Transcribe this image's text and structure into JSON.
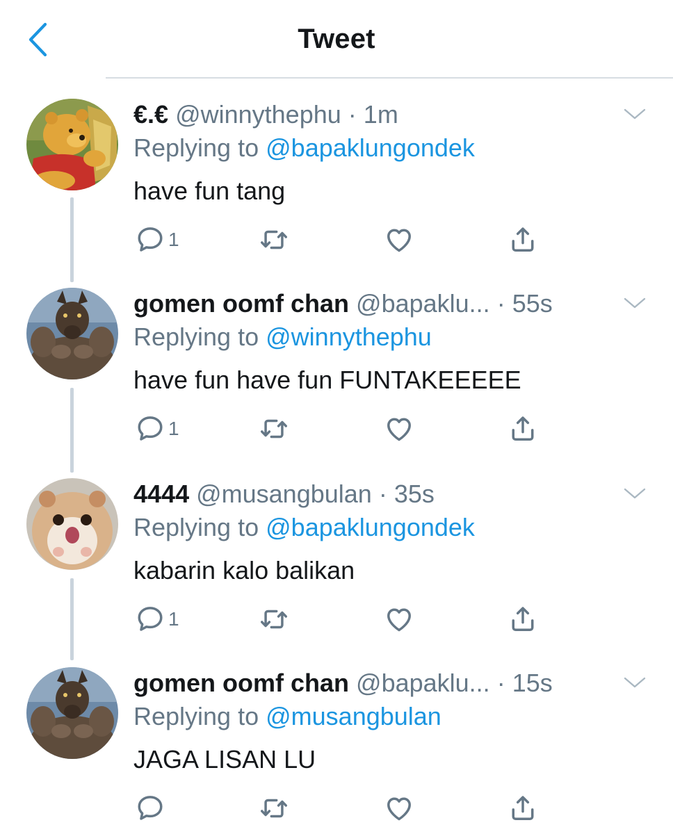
{
  "header": {
    "title": "Tweet",
    "back_icon": "chevron-left-icon",
    "accent_color": "#1b95e0"
  },
  "tweets": [
    {
      "display_name": "€.€",
      "handle": "@winnythephu",
      "dot": "·",
      "time": "1m",
      "replying_prefix": "Replying to",
      "replying_to": "@bapaklungondek",
      "text": "have fun tang",
      "reply_count": "1",
      "avatar": "pooh-bear-avatar"
    },
    {
      "display_name": "gomen oomf chan",
      "handle": "@bapaklu...",
      "dot": "·",
      "time": "55s",
      "replying_prefix": "Replying to",
      "replying_to": "@winnythephu",
      "text": "have fun have fun FUNTAKEEEEE",
      "reply_count": "1",
      "avatar": "werewolf-avatar"
    },
    {
      "display_name": "4444",
      "handle": "@musangbulan",
      "dot": "·",
      "time": "35s",
      "replying_prefix": "Replying to",
      "replying_to": "@bapaklungondek",
      "text": "kabarin kalo balikan",
      "reply_count": "1",
      "avatar": "hamster-avatar"
    },
    {
      "display_name": "gomen oomf chan",
      "handle": "@bapaklu...",
      "dot": "·",
      "time": "15s",
      "replying_prefix": "Replying to",
      "replying_to": "@musangbulan",
      "text": "JAGA LISAN LU",
      "reply_count": "",
      "avatar": "werewolf-avatar"
    }
  ],
  "colors": {
    "text_primary": "#14171a",
    "text_secondary": "#657786",
    "link": "#1b95e0",
    "thread_line": "#c9d3dc"
  }
}
